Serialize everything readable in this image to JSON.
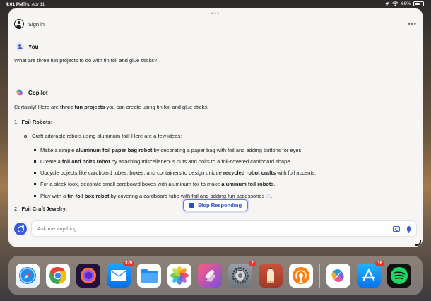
{
  "status": {
    "time": "4:01 PM",
    "date": "Thu Apr 11",
    "battery": "68%",
    "battery_level": 0.68
  },
  "header": {
    "signin_label": "Sign in",
    "more_label": "•••",
    "grabber": "•••"
  },
  "user": {
    "name": "You",
    "message": "What are three fun projects to do with tin foil and glue sticks?"
  },
  "bot": {
    "name": "Copilot",
    "intro_a": "Certainly! Here are ",
    "intro_b": "three fun projects",
    "intro_c": " you can create using tin foil and glue sticks:",
    "section1_num": "1.",
    "section1_title": "Foil Robots",
    "section1_colon": ":",
    "sub1": "Craft adorable robots using aluminum foil! Here are a few ideas:",
    "items": [
      {
        "a": "Make a simple ",
        "b": "aluminum foil paper bag robot",
        "c": " by decorating a paper bag with foil and adding buttons for eyes."
      },
      {
        "a": "Create a ",
        "b": "foil and bolts robot",
        "c": " by attaching miscellaneous nuts and bolts to a foil-covered cardboard shape."
      },
      {
        "a": "Upcycle objects like cardboard tubes, boxes, and containers to design unique ",
        "b": "recycled robot crafts",
        "c": " with foil accents."
      },
      {
        "a": "For a sleek look, decorate small cardboard boxes with aluminum foil to make ",
        "b": "aluminum foil robots",
        "c": "."
      },
      {
        "a": "Play with a ",
        "b": "tin foil box robot",
        "c": " by covering a cardboard tube with foil and adding fun accessories ",
        "footnote": "1",
        "end": "."
      }
    ],
    "section2_num": "2.",
    "section2_title": "Foil Craft Jewelry",
    "section2_colon": ":"
  },
  "stop_button": {
    "label": "Stop Responding"
  },
  "composer": {
    "placeholder": "Ask me anything..."
  },
  "dock": {
    "apps": [
      {
        "name": "Safari",
        "icon": "safari-icon"
      },
      {
        "name": "Chrome",
        "icon": "chrome-icon"
      },
      {
        "name": "Firefox",
        "icon": "firefox-icon"
      },
      {
        "name": "Mail",
        "icon": "mail-icon",
        "badge": "379"
      },
      {
        "name": "Files",
        "icon": "files-icon"
      },
      {
        "name": "Photos",
        "icon": "photos-icon"
      },
      {
        "name": "Shortcuts",
        "icon": "shortcuts-icon"
      },
      {
        "name": "Settings",
        "icon": "settings-icon",
        "badge": "2"
      },
      {
        "name": "Notes",
        "icon": "pencil-app-icon"
      },
      {
        "name": "Overcast",
        "icon": "podcast-icon"
      },
      {
        "name": "Copilot",
        "icon": "copilot-icon"
      },
      {
        "name": "App Store",
        "icon": "app-store-icon",
        "badge": "16"
      },
      {
        "name": "Spotify",
        "icon": "spotify-icon"
      }
    ]
  },
  "colors": {
    "accent": "#3c5bd6",
    "badge": "#e8352d",
    "window_bg": "#f6f5f3"
  }
}
